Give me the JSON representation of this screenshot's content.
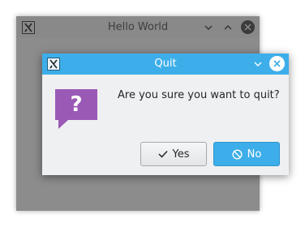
{
  "parent_window": {
    "title": "Hello World",
    "icons": [
      "app-logo-icon",
      "minimize-icon",
      "maximize-icon",
      "close-icon"
    ]
  },
  "dialog": {
    "title": "Quit",
    "message": "Are you sure you want to quit?",
    "icon": "question-icon",
    "buttons": {
      "yes_label": "Yes",
      "no_label": "No"
    }
  },
  "colors": {
    "accent": "#3daee9",
    "question_icon": "#9b59b6",
    "dialog_bg": "#eff0f1",
    "dimmed_window": "#8c8c8c"
  }
}
